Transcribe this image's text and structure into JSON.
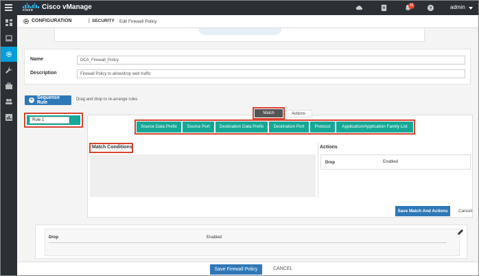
{
  "app": {
    "brand": "cisco",
    "title": "Cisco vManage",
    "user": "admin",
    "notification_count": "10"
  },
  "breadcrumb": {
    "section": "CONFIGURATION",
    "separator": "|",
    "subsection": "SECURITY",
    "page": "Edit Firewall Policy"
  },
  "policy": {
    "name_label": "Name",
    "name_value": "DCA_Firewall_Policy",
    "description_label": "Description",
    "description_value": "Firewall Policy to allow/drop web traffic"
  },
  "sequence": {
    "button_label": "Sequence Rule",
    "drag_note": "Drag and drop to re-arrange rules",
    "rule_name": "Rule 1"
  },
  "tabs": {
    "match": "Match",
    "actions": "Actions"
  },
  "match_filters": [
    "Source Data Prefix",
    "Source Port",
    "Destination Data Prefix",
    "Destination Port",
    "Protocol",
    "Application/Application Family List"
  ],
  "match_conditions": {
    "title": "Match Conditions"
  },
  "actions_panel": {
    "title": "Actions",
    "action_name": "Drop",
    "action_value": "Enabled"
  },
  "buttons": {
    "save_match": "Save Match And Actions",
    "cancel_small": "Cancel",
    "save_policy": "Save Firewall Policy",
    "cancel_main": "CANCEL"
  },
  "summary": {
    "action_name": "Drop",
    "action_value": "Enabled"
  },
  "colors": {
    "accent_teal": "#16a896",
    "primary_blue": "#2f78b7",
    "highlight_red": "#d9432f",
    "nav_dark": "#2b2f36",
    "nav_active": "#049fd9"
  }
}
